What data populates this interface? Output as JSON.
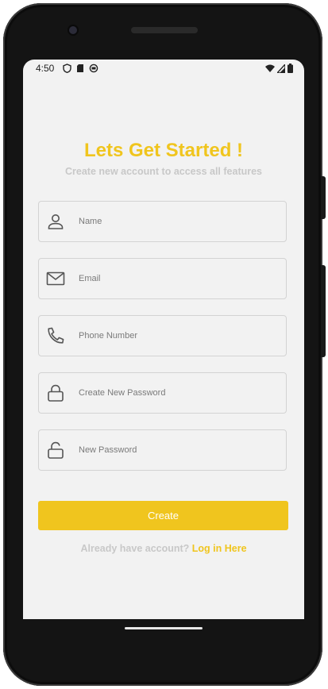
{
  "status_bar": {
    "time": "4:50",
    "left_icons": [
      "shield-icon",
      "sd-card-icon",
      "sync-icon"
    ],
    "right_icons": [
      "wifi-icon",
      "signal-icon",
      "battery-icon"
    ]
  },
  "header": {
    "title": "Lets Get Started !",
    "subtitle": "Create new account to access all features"
  },
  "form": {
    "fields": [
      {
        "icon": "person-icon",
        "placeholder": "Name"
      },
      {
        "icon": "mail-icon",
        "placeholder": "Email"
      },
      {
        "icon": "phone-icon",
        "placeholder": "Phone Number"
      },
      {
        "icon": "lock-icon",
        "placeholder": "Create New Password"
      },
      {
        "icon": "unlock-icon",
        "placeholder": "New Password"
      }
    ],
    "submit_label": "Create"
  },
  "footer": {
    "question": "Already have account? ",
    "link": "Log in Here"
  },
  "colors": {
    "accent": "#f0c51e",
    "muted_text": "#c8c8c8",
    "screen_bg": "#f2f2f2",
    "field_border": "#d3d3d3"
  }
}
